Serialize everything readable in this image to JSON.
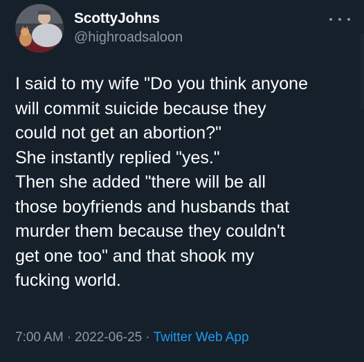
{
  "author": {
    "display_name": "ScottyJohns",
    "handle": "@highroadsaloon",
    "avatar_icon": "profile-photo-person-with-dog"
  },
  "menu_icon": "more-options-icon",
  "tweet": {
    "lines": [
      "I said to my wife \"Do you think anyone",
      "will commit suicide because they",
      "could not get an abortion?\"",
      "She instantly replied \"yes.\"",
      "Then she added \"there will be all",
      "those boyfriends and husbands that",
      "murder them because they couldn't",
      "get one too\" and that shook my",
      "fucking world."
    ]
  },
  "meta": {
    "time": "7:00 AM",
    "separator": "·",
    "date": "2022-06-25",
    "source": "Twitter Web App"
  },
  "colors": {
    "background": "#15202b",
    "secondary_text": "#8b98a5",
    "link": "#1d9bf0"
  }
}
